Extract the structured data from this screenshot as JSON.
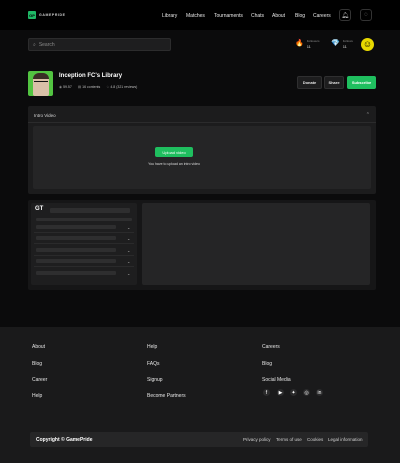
{
  "brand": {
    "logo_mark": "GP",
    "name": "GAMEPRIDE"
  },
  "nav": {
    "links": [
      "Library",
      "Matches",
      "Tournaments",
      "Chats",
      "About",
      "Blog",
      "Careers"
    ],
    "icons": [
      "bell-icon",
      "chat-icon"
    ]
  },
  "search": {
    "placeholder": "Search"
  },
  "stats": [
    {
      "label": "Followers",
      "value": "11",
      "icon": "follower-icon"
    },
    {
      "label": "Follows",
      "value": "11",
      "icon": "diamond-icon"
    }
  ],
  "profile": {
    "title": "Inception FC's Library",
    "views": "59.57",
    "contents": "16 contents",
    "rating": "4.8 (321 reviews)"
  },
  "actions": {
    "donate": "Donate",
    "share": "Share",
    "subscribe": "Subscribe"
  },
  "intro": {
    "heading": "Intro Video",
    "upload_button": "Upload video",
    "note": "You have to upload an intro video"
  },
  "course": {
    "logo": "GT"
  },
  "footer": {
    "col1": [
      "About",
      "Blog",
      "Career",
      "Help"
    ],
    "col2": [
      "Help",
      "FAQs",
      "Signup",
      "Become Partners"
    ],
    "col3": [
      "Careers",
      "Blog",
      "Social Media"
    ],
    "social": [
      "facebook-icon",
      "youtube-icon",
      "twitter-icon",
      "instagram-icon",
      "linkedin-icon"
    ],
    "copyright": "Copyright © GamePride",
    "legal": [
      "Privacy policy",
      "Terms of use",
      "Cookies",
      "Legal information"
    ]
  },
  "colors": {
    "accent": "#1fbf5f",
    "background": "#0b0b0c",
    "panel": "#1c1c1d"
  }
}
